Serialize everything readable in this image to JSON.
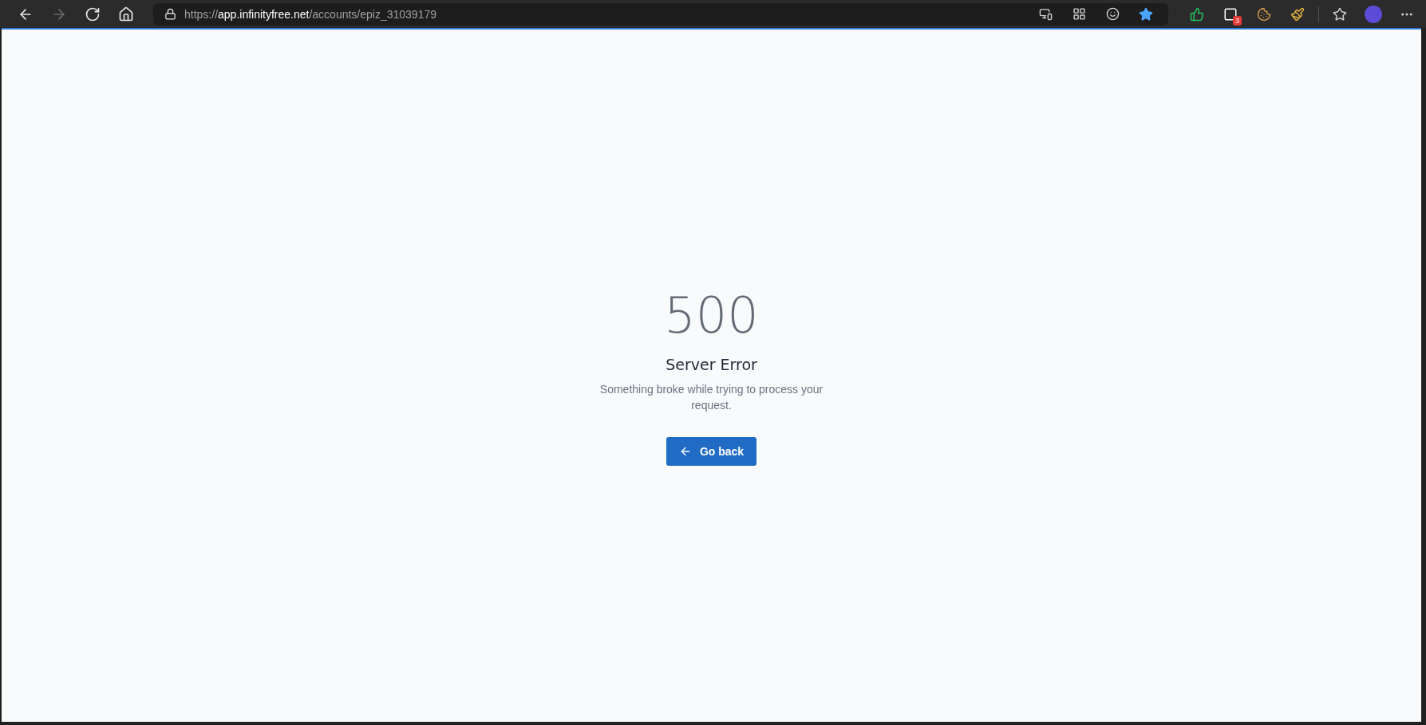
{
  "browser": {
    "nav": [
      {
        "kind": "back",
        "disabled": false
      },
      {
        "kind": "forward",
        "disabled": true
      },
      {
        "kind": "reload",
        "disabled": false
      },
      {
        "kind": "home",
        "disabled": false
      }
    ],
    "url": {
      "scheme": "https://",
      "host": "app.infinityfree.net",
      "path": "/accounts/epiz_31039179"
    },
    "favorited": true,
    "extensions": [
      {
        "kind": "thumb"
      },
      {
        "kind": "box",
        "badge": "3"
      },
      {
        "kind": "cookie"
      },
      {
        "kind": "paint"
      }
    ]
  },
  "error": {
    "code": "500",
    "title": "Server Error",
    "message": "Something broke while trying to process your request.",
    "button": "Go back"
  }
}
